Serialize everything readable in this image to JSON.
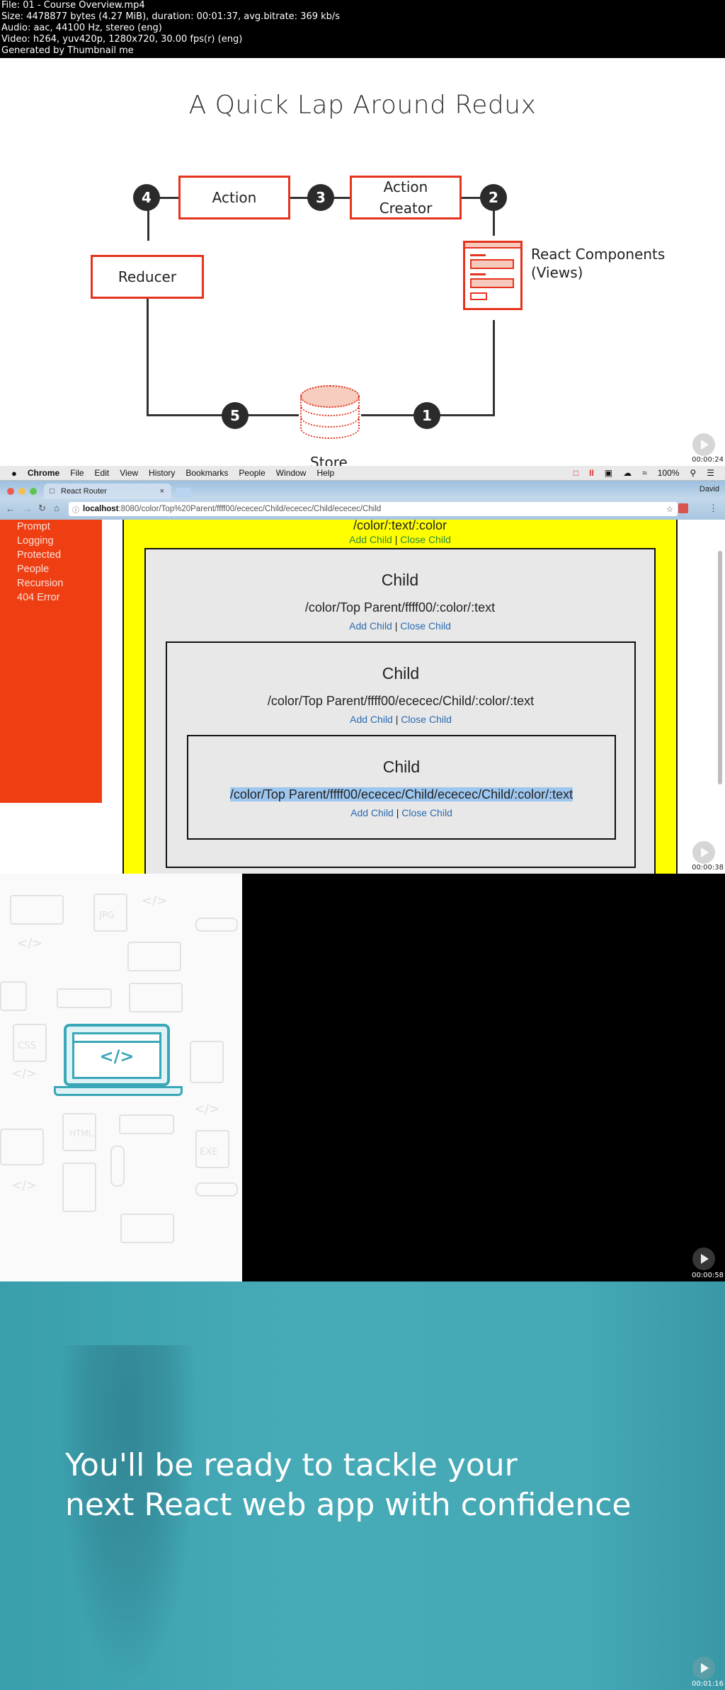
{
  "file_info": {
    "line1": "File: 01 - Course Overview.mp4",
    "line2": "Size: 4478877 bytes (4.27 MiB), duration: 00:01:37, avg.bitrate: 369 kb/s",
    "line3": "Audio: aac, 44100 Hz, stereo (eng)",
    "line4": "Video: h264, yuv420p, 1280x720, 30.00 fps(r) (eng)",
    "line5": "Generated by Thumbnail me"
  },
  "frames": [
    {
      "timestamp": "00:00:24",
      "slide_title": "A Quick Lap Around Redux",
      "diagram": {
        "nodes": {
          "action": "Action",
          "action_creator": "Action Creator",
          "reducer": "Reducer",
          "store": "Store",
          "views": "React Components (Views)"
        },
        "steps": [
          "1",
          "2",
          "3",
          "4",
          "5"
        ]
      }
    },
    {
      "timestamp": "00:00:38",
      "mac_menu": [
        "Chrome",
        "File",
        "Edit",
        "View",
        "History",
        "Bookmarks",
        "People",
        "Window",
        "Help"
      ],
      "status_battery": "100%",
      "tab_title": "React Router",
      "tab_close": "×",
      "profile_name": "David",
      "url_host": "localhost",
      "url_rest": ":8080/color/Top%20Parent/ffff00/ececec/Child/ececec/Child/ececec/Child",
      "sidebar_links": [
        "Prompt",
        "Logging",
        "Protected",
        "People",
        "Recursion",
        "404 Error"
      ],
      "top_path": "/color/:text/:color",
      "add_child": "Add Child",
      "separator": "|",
      "close_child": "Close Child",
      "children": [
        {
          "title": "Child",
          "path": "/color/Top Parent/ffff00/:color/:text"
        },
        {
          "title": "Child",
          "path": "/color/Top Parent/ffff00/ececec/Child/:color/:text"
        },
        {
          "title": "Child",
          "path": "/color/Top Parent/ffff00/ececec/Child/ececec/Child/:color/:text"
        }
      ],
      "colors": {
        "sidebar": "#ef3e12",
        "parent": "#ffff00",
        "child": "#e8e8e8",
        "link": "#2a6bb0"
      }
    },
    {
      "timestamp": "00:00:58",
      "pattern_labels": [
        "JPG",
        "CSS",
        "HTML",
        "EXE",
        "</>"
      ]
    },
    {
      "timestamp": "00:01:16",
      "tagline_line1": "You'll be ready to tackle your",
      "tagline_line2": "next React web app with confidence"
    }
  ]
}
